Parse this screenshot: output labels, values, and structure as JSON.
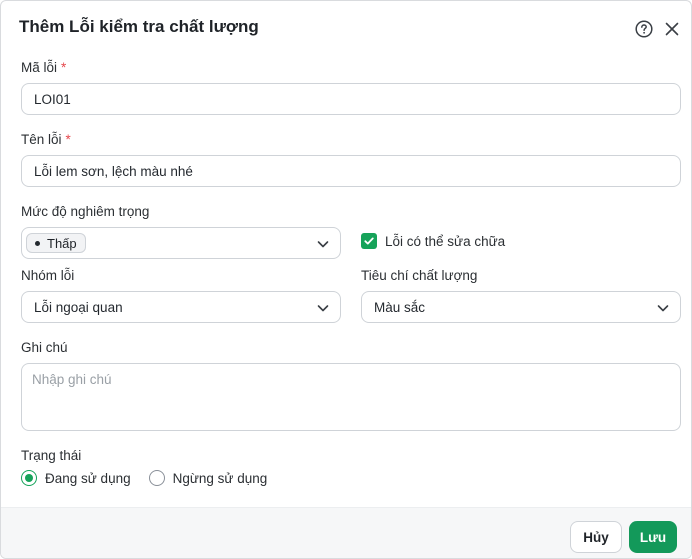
{
  "dialog": {
    "title": "Thêm Lỗi kiểm tra chất lượng",
    "help_icon": "question-circle-icon",
    "close_icon": "close-icon"
  },
  "fields": {
    "code": {
      "label": "Mã lỗi",
      "required": "*",
      "value": "LOI01"
    },
    "name": {
      "label": "Tên lỗi",
      "required": "*",
      "value": "Lỗi lem sơn, lệch màu nhé"
    },
    "severity": {
      "label": "Mức độ nghiêm trọng",
      "value": "Thấp"
    },
    "fixable": {
      "label": "Lỗi có thể sửa chữa",
      "checked": true
    },
    "group": {
      "label": "Nhóm lỗi",
      "value": "Lỗi ngoại quan"
    },
    "criteria": {
      "label": "Tiêu chí chất lượng",
      "value": "Màu sắc"
    },
    "note": {
      "label": "Ghi chú",
      "placeholder": "Nhập ghi chú"
    },
    "status": {
      "label": "Trạng thái",
      "options": [
        "Đang sử dụng",
        "Ngừng sử dụng"
      ],
      "selected": "Đang sử dụng"
    }
  },
  "footer": {
    "cancel_label": "Hủy",
    "save_label": "Lưu"
  },
  "colors": {
    "accent": "#16a35a",
    "required": "#e5484d"
  }
}
